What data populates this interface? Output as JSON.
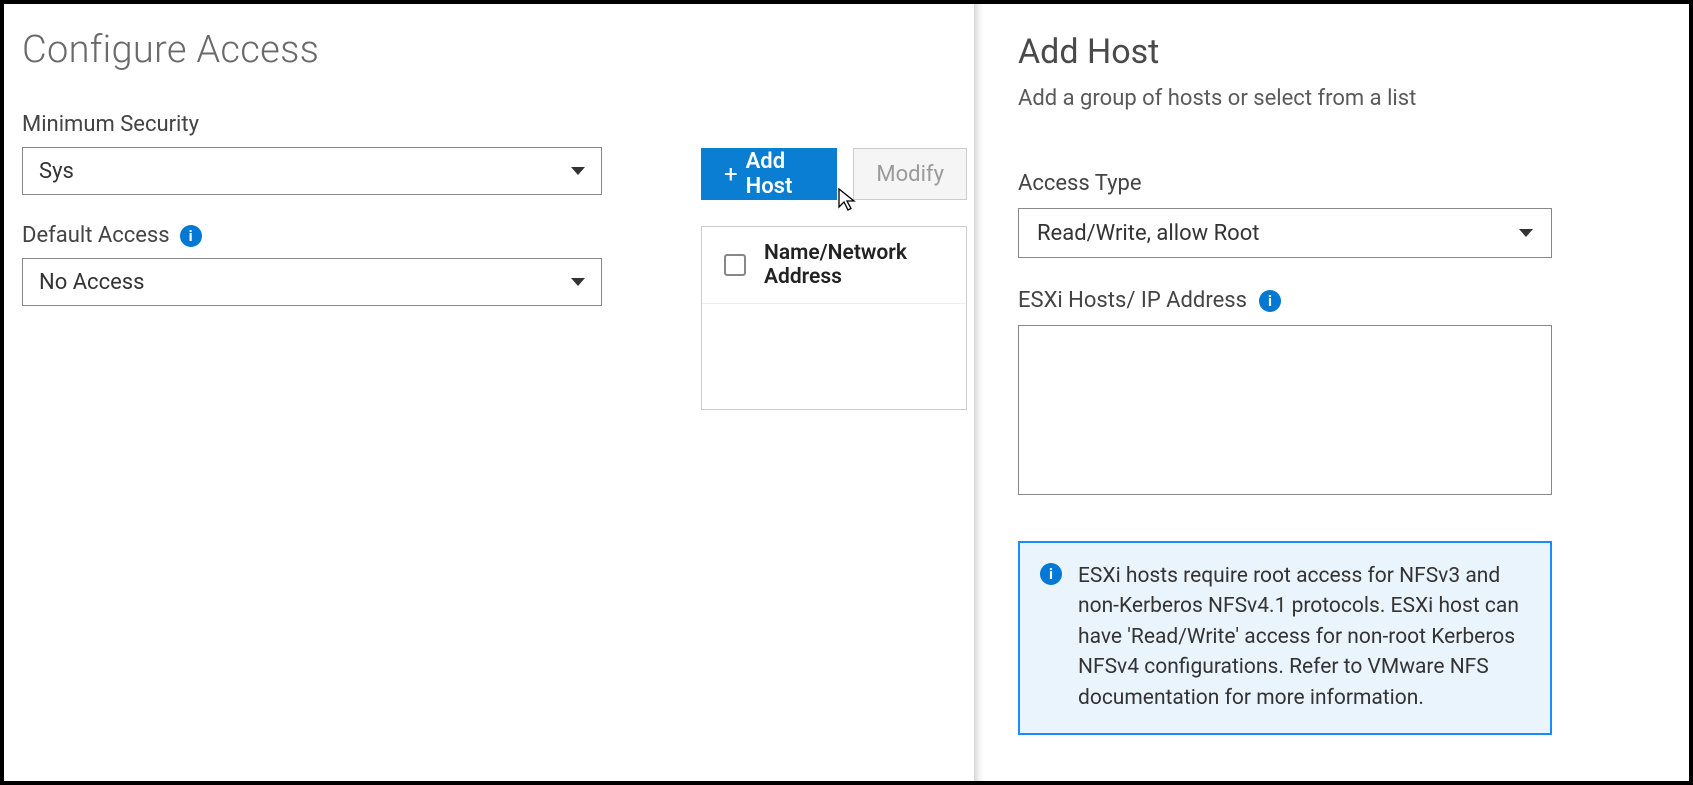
{
  "left": {
    "title": "Configure Access",
    "min_security_label": "Minimum Security",
    "min_security_value": "Sys",
    "default_access_label": "Default Access",
    "default_access_value": "No Access"
  },
  "toolbar": {
    "add_host_label": "Add Host",
    "modify_label": "Modify",
    "table_header": "Name/Network Address"
  },
  "panel": {
    "title": "Add Host",
    "subtitle": "Add a group of hosts or select from a list",
    "access_type_label": "Access Type",
    "access_type_value": "Read/Write, allow Root",
    "hosts_label": "ESXi Hosts/ IP Address",
    "hosts_value": "",
    "info_text": "ESXi hosts require root access for NFSv3 and non-Kerberos NFSv4.1 protocols. ESXi host can have 'Read/Write' access for non-root Kerberos NFSv4 configurations. Refer to VMware NFS documentation for more information."
  }
}
